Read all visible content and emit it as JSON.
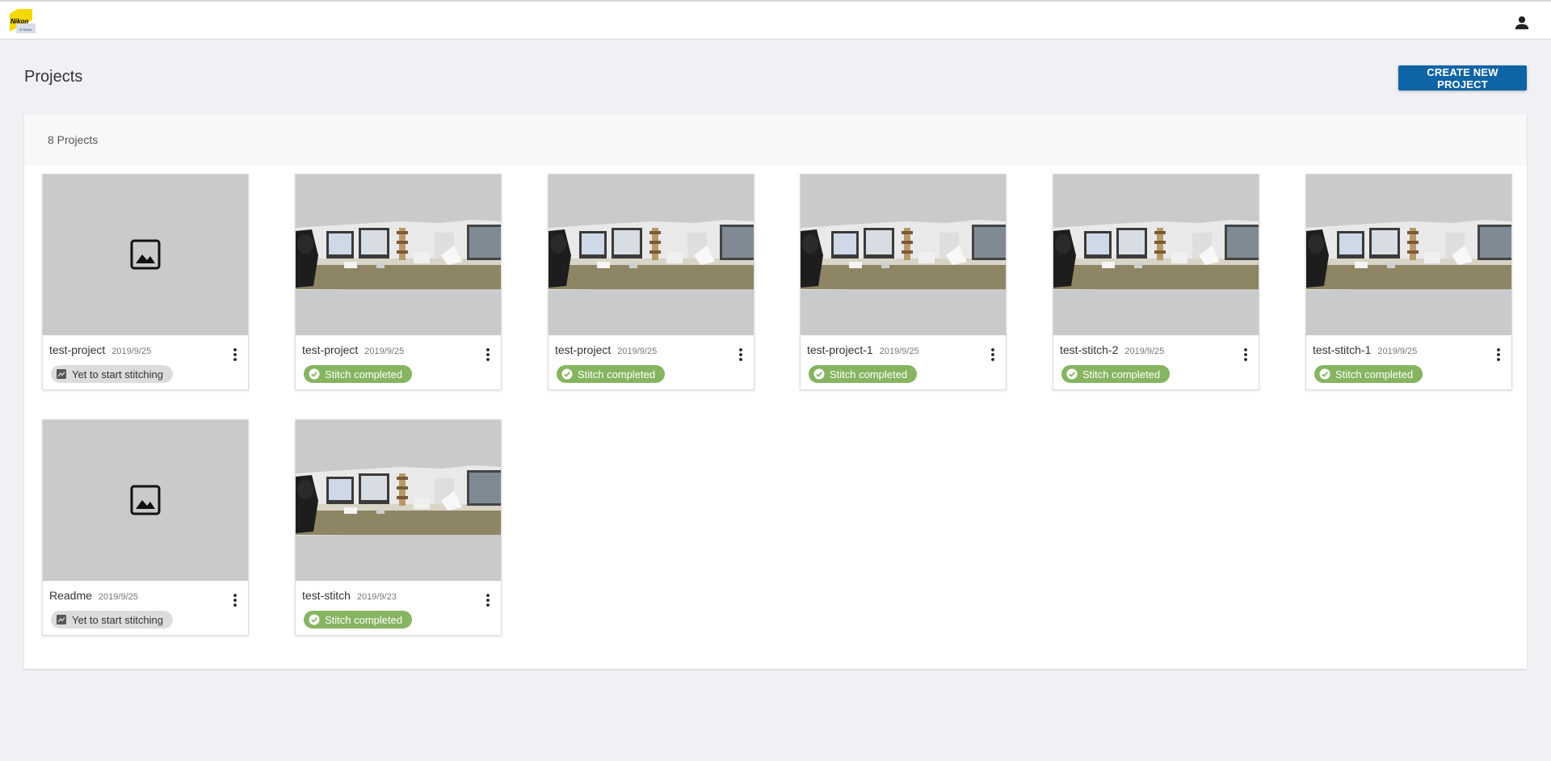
{
  "header": {
    "logo_text": "Nikon",
    "logo_subtext": "3i Studio"
  },
  "page": {
    "title": "Projects",
    "create_button_label": "CREATE NEW PROJECT"
  },
  "panel": {
    "count_label": "8 Projects"
  },
  "projects": [
    {
      "name": "test-project",
      "date": "2019/9/25",
      "status": "Yet to start stitching",
      "status_type": "pending",
      "has_image": false
    },
    {
      "name": "test-project",
      "date": "2019/9/25",
      "status": "Stitch completed",
      "status_type": "done",
      "has_image": true
    },
    {
      "name": "test-project",
      "date": "2019/9/25",
      "status": "Stitch completed",
      "status_type": "done",
      "has_image": true
    },
    {
      "name": "test-project-1",
      "date": "2019/9/25",
      "status": "Stitch completed",
      "status_type": "done",
      "has_image": true
    },
    {
      "name": "test-stitch-2",
      "date": "2019/9/25",
      "status": "Stitch completed",
      "status_type": "done",
      "has_image": true
    },
    {
      "name": "test-stitch-1",
      "date": "2019/9/25",
      "status": "Stitch completed",
      "status_type": "done",
      "has_image": true
    },
    {
      "name": "Readme",
      "date": "2019/9/25",
      "status": "Yet to start stitching",
      "status_type": "pending",
      "has_image": false
    },
    {
      "name": "test-stitch",
      "date": "2019/9/23",
      "status": "Stitch completed",
      "status_type": "done",
      "has_image": true
    }
  ],
  "colors": {
    "accent": "#0f64a6",
    "status_done": "#86b460",
    "status_pending": "#dcdcdc",
    "background": "#f1f1f5"
  },
  "icons": {
    "user": "person-icon",
    "placeholder": "image-icon",
    "menu": "more-vert-icon",
    "done": "check-circle-icon",
    "pending": "stitch-pending-icon"
  }
}
